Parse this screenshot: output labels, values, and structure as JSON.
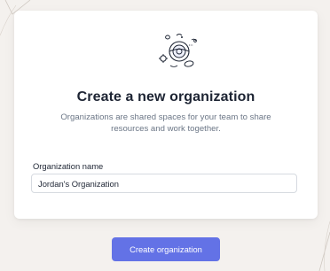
{
  "header": {
    "title": "Create a new organization",
    "subtitle": "Organizations are shared spaces for your team to share resources and work together."
  },
  "form": {
    "org_name_label": "Organization name",
    "org_name_value": "Jordan's Organization"
  },
  "actions": {
    "create_label": "Create organization"
  },
  "icons": {
    "illustration": "organization-rings-illustration"
  },
  "colors": {
    "primary": "#6372e6",
    "background": "#f4f1ee",
    "card": "#ffffff",
    "title": "#1d2433",
    "muted": "#6b7686"
  }
}
